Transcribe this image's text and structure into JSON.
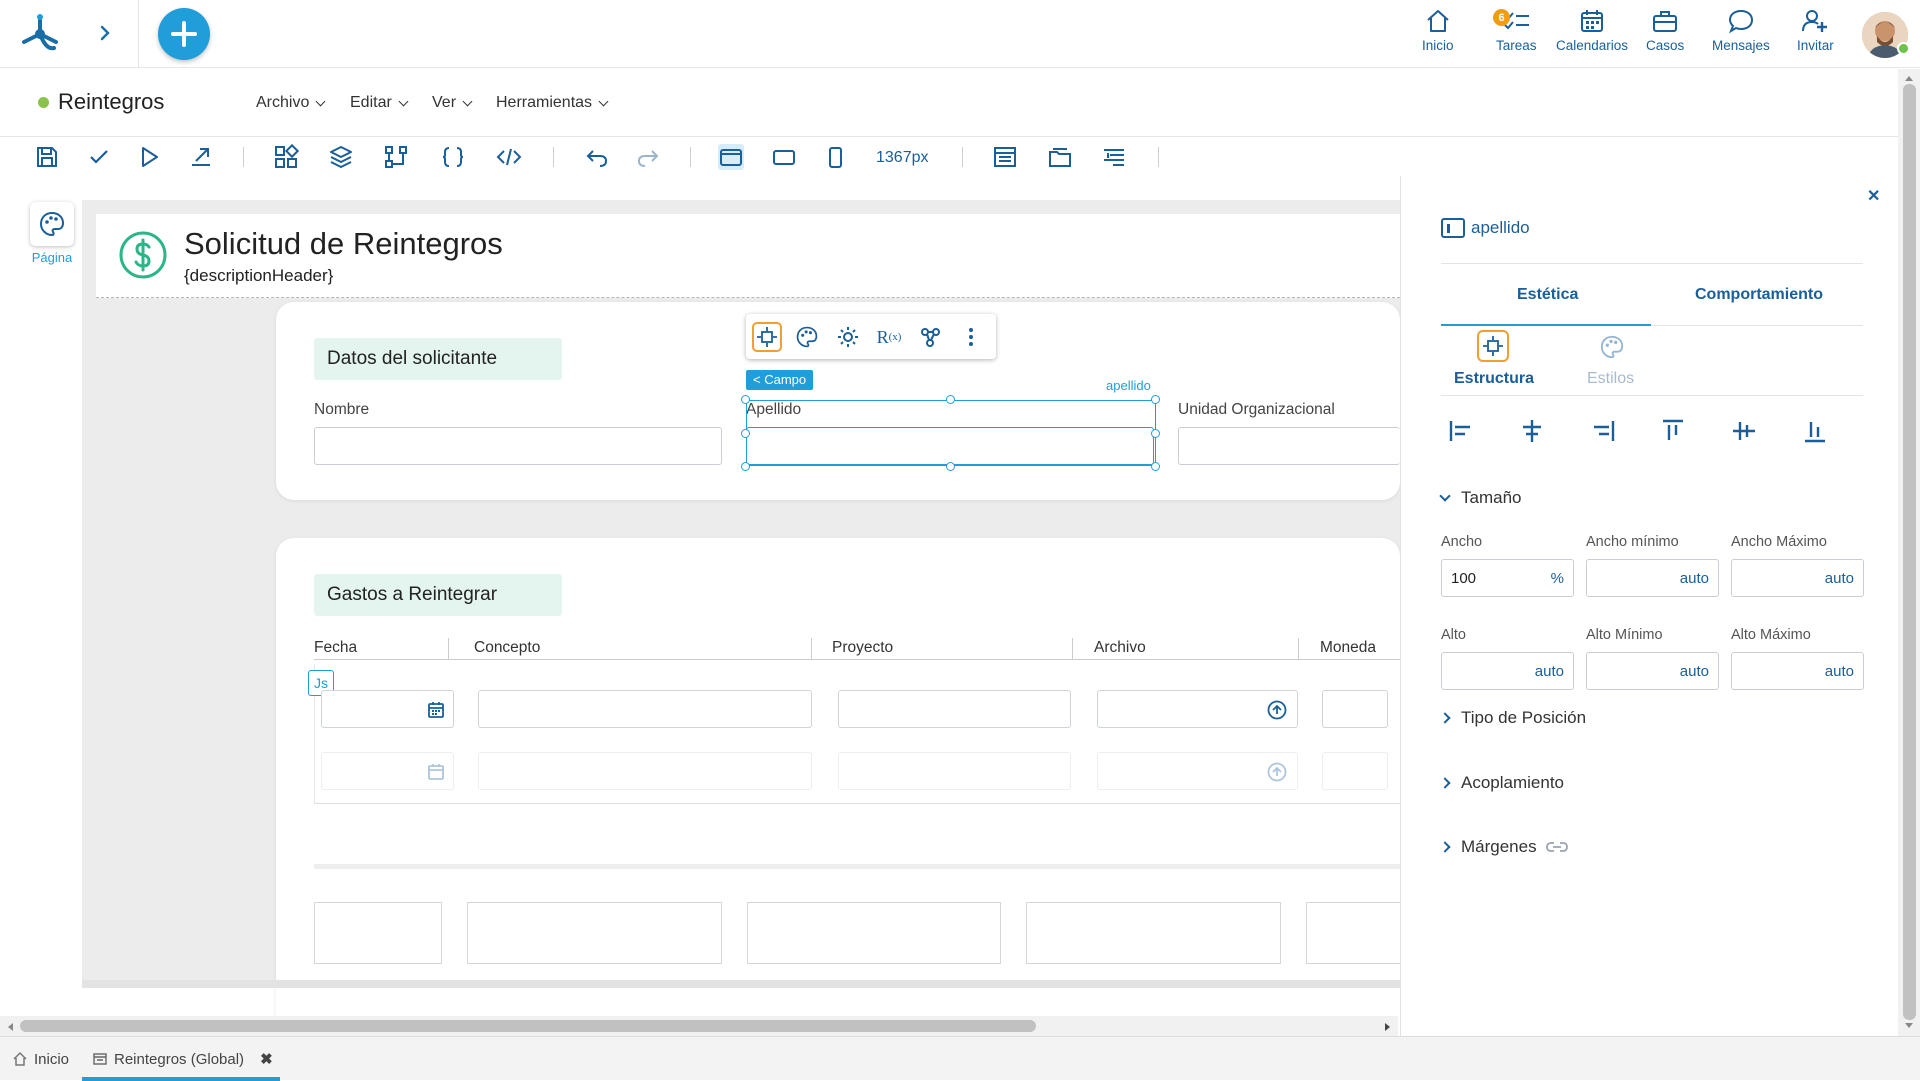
{
  "topbar": {
    "nav": [
      {
        "label": "Inicio",
        "icon": "home-icon"
      },
      {
        "label": "Tareas",
        "icon": "tasks-icon",
        "badge": "6"
      },
      {
        "label": "Calendarios",
        "icon": "calendar-icon"
      },
      {
        "label": "Casos",
        "icon": "briefcase-icon"
      },
      {
        "label": "Mensajes",
        "icon": "message-icon"
      },
      {
        "label": "Invitar",
        "icon": "invite-user-icon"
      }
    ],
    "status_color": "#6cc24a"
  },
  "menubar": {
    "title": "Reintegros",
    "status_color": "#8bc34a",
    "menus": [
      "Archivo",
      "Editar",
      "Ver",
      "Herramientas"
    ]
  },
  "toolbar": {
    "width_label": "1367px"
  },
  "canvas": {
    "page_label": "Página",
    "header": {
      "title": "Solicitud de Reintegros",
      "description": "{descriptionHeader}"
    },
    "section1": {
      "title": "Datos del solicitante",
      "fields": [
        "Nombre",
        "Apellido",
        "Unidad Organizacional"
      ],
      "selected_field_tag": "apellido",
      "breadcrumb": "< Campo"
    },
    "section2": {
      "title": "Gastos a Reintegrar",
      "columns": [
        "Fecha",
        "Concepto",
        "Proyecto",
        "Archivo",
        "Moneda"
      ],
      "js_badge": "Js"
    },
    "accent": "#1f9ed9",
    "section_bg": "#e4f5ef"
  },
  "panel": {
    "title": "apellido",
    "tabs": [
      "Estética",
      "Comportamiento"
    ],
    "subtabs": [
      "Estructura",
      "Estilos"
    ],
    "tamano": {
      "heading": "Tamaño",
      "labels": [
        "Ancho",
        "Ancho mínimo",
        "Ancho Máximo",
        "Alto",
        "Alto Mínimo",
        "Alto Máximo"
      ],
      "ancho_value": "100",
      "ancho_unit": "%",
      "auto": "auto"
    },
    "sections": [
      "Tipo de Posición",
      "Acoplamiento",
      "Márgenes"
    ],
    "highlight_color": "#f0a030"
  },
  "bottom_tabs": [
    "Inicio",
    "Reintegros (Global)"
  ]
}
